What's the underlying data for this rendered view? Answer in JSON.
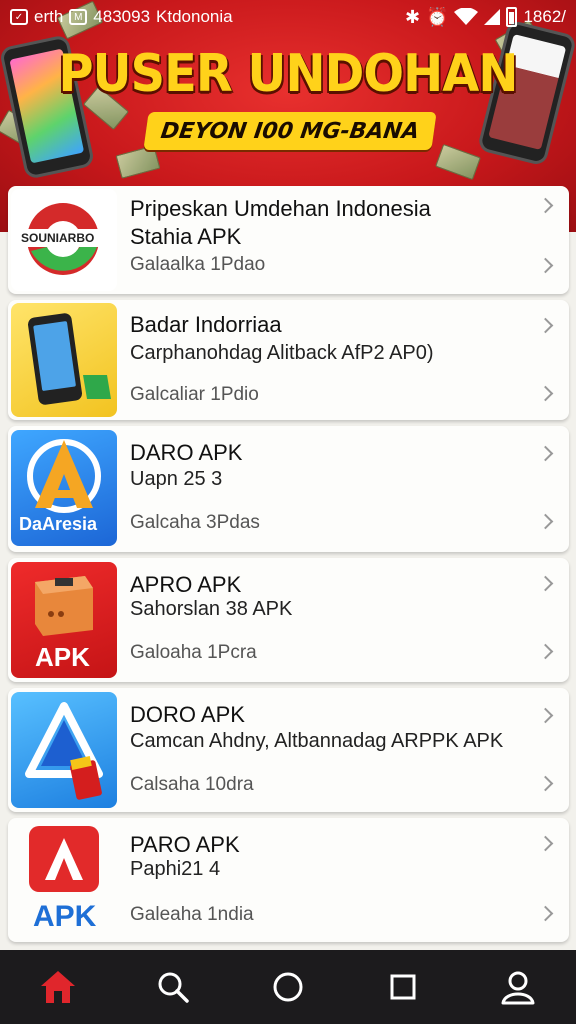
{
  "status_bar": {
    "left_text_1": "erth",
    "left_text_2": "483093",
    "left_text_3": "Ktdononia",
    "time": "1862/",
    "icons": [
      "shield-icon",
      "dual-sim-icon",
      "bluetooth-icon",
      "alarm-icon",
      "wifi-icon",
      "signal-icon",
      "battery-icon"
    ]
  },
  "banner": {
    "title": "PUSER UNDOHAN",
    "subtitle": "DEYON I00 MG-BANA"
  },
  "apps": [
    {
      "title": "Pripeskan Umdehan Indonesia",
      "subtitle": "Stahia APK",
      "meta": "Galaalka 1Pdao",
      "icon_label": "SOUNIARBO"
    },
    {
      "title": "Badar Indorriaa",
      "subtitle": "Carphanohdag Alitback AfP2 AP0)",
      "meta": "Galcaliar 1Pdio",
      "icon_label": ""
    },
    {
      "title": "DARO APK",
      "subtitle": "Uapn 25 3",
      "meta": "Galcaha 3Pdas",
      "icon_label": "DaAresia"
    },
    {
      "title": "APRO APK",
      "subtitle": "Sahorslan 38 APK",
      "meta": "Galoaha 1Pcra",
      "icon_label": "APK"
    },
    {
      "title": "DORO APK",
      "subtitle": "Camcan Ahdny, Altbannadag ARPPK APK",
      "meta": "Calsaha 10dra",
      "icon_label": ""
    },
    {
      "title": "PARO APK",
      "subtitle": "Paphi21 4",
      "meta": "Galeaha 1ndia",
      "icon_label": "APK"
    }
  ],
  "nav": {
    "items": [
      "home-icon",
      "search-icon",
      "circle-home-icon",
      "square-recents-icon",
      "profile-icon"
    ],
    "active_color": "#e0262c",
    "inactive_color": "#ffffff"
  }
}
